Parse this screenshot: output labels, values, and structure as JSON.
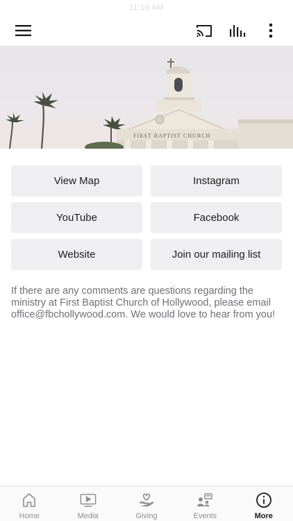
{
  "status_bar": {
    "time": "11:10 AM"
  },
  "top_bar": {
    "menu_icon": "hamburger-menu-icon",
    "cast_icon": "cast-icon",
    "audio_icon": "audio-bars-icon",
    "more_icon": "vertical-dots-icon"
  },
  "hero": {
    "building_sign": "FIRST BAPTIST CHURCH"
  },
  "links": [
    {
      "label": "View Map"
    },
    {
      "label": "Instagram"
    },
    {
      "label": "YouTube"
    },
    {
      "label": "Facebook"
    },
    {
      "label": "Website"
    },
    {
      "label": "Join our mailing list"
    }
  ],
  "info_text": "If there are any comments are questions regarding the ministry at First Baptist Church of Hollywood, please email office@fbchollywood.com.  We would love to hear from you!",
  "tabs": [
    {
      "label": "Home",
      "icon": "home-icon"
    },
    {
      "label": "Media",
      "icon": "media-play-icon"
    },
    {
      "label": "Giving",
      "icon": "giving-hand-heart-icon"
    },
    {
      "label": "Events",
      "icon": "events-icon"
    },
    {
      "label": "More",
      "icon": "info-circle-icon",
      "active": true
    }
  ],
  "colors": {
    "button_bg": "#efeff2",
    "text": "#1c1c1e",
    "muted_text": "#707078",
    "tab_inactive": "#8e8e93"
  }
}
